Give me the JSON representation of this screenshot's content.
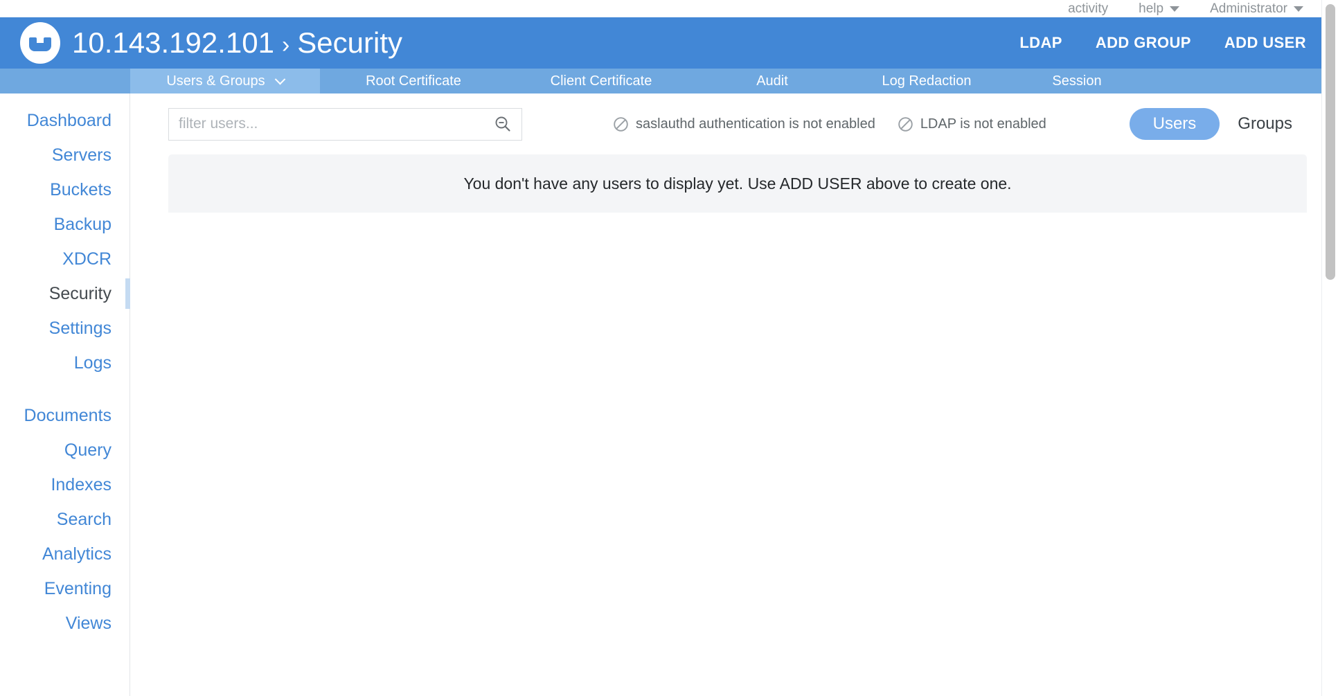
{
  "utility_bar": {
    "items": [
      {
        "label": "activity",
        "has_caret": false
      },
      {
        "label": "help",
        "has_caret": true
      },
      {
        "label": "Administrator",
        "has_caret": true
      }
    ]
  },
  "header": {
    "logo_icon": "couchbase-logo-icon",
    "cluster": "10.143.192.101",
    "separator": "›",
    "section": "Security",
    "actions": [
      "LDAP",
      "ADD GROUP",
      "ADD USER"
    ]
  },
  "tabs": [
    {
      "label": "Users & Groups",
      "active": true,
      "has_caret": true
    },
    {
      "label": "Root Certificate",
      "active": false,
      "has_caret": false
    },
    {
      "label": "Client Certificate",
      "active": false,
      "has_caret": false
    },
    {
      "label": "Audit",
      "active": false,
      "has_caret": false
    },
    {
      "label": "Log Redaction",
      "active": false,
      "has_caret": false
    },
    {
      "label": "Session",
      "active": false,
      "has_caret": false
    }
  ],
  "sidebar": {
    "group_one": [
      {
        "label": "Dashboard",
        "active": false
      },
      {
        "label": "Servers",
        "active": false
      },
      {
        "label": "Buckets",
        "active": false
      },
      {
        "label": "Backup",
        "active": false
      },
      {
        "label": "XDCR",
        "active": false
      },
      {
        "label": "Security",
        "active": true
      },
      {
        "label": "Settings",
        "active": false
      },
      {
        "label": "Logs",
        "active": false
      }
    ],
    "group_two": [
      {
        "label": "Documents",
        "active": false
      },
      {
        "label": "Query",
        "active": false
      },
      {
        "label": "Indexes",
        "active": false
      },
      {
        "label": "Search",
        "active": false
      },
      {
        "label": "Analytics",
        "active": false
      },
      {
        "label": "Eventing",
        "active": false
      },
      {
        "label": "Views",
        "active": false
      }
    ]
  },
  "toolbar": {
    "filter": {
      "value": "",
      "placeholder": "filter users...",
      "icon": "search-zoom-out-icon"
    },
    "statuses": [
      {
        "icon": "prohibited-icon",
        "text": "saslauthd authentication is not enabled"
      },
      {
        "icon": "prohibited-icon",
        "text": "LDAP is not enabled"
      }
    ],
    "toggle": {
      "users_label": "Users",
      "groups_label": "Groups",
      "selected": "Users"
    }
  },
  "main": {
    "empty_message": "You don't have any users to display yet. Use ADD USER above to create one."
  },
  "colors": {
    "header_blue": "#4287d6",
    "tab_blue": "#6fa8e0",
    "tab_active_blue": "#8cbcea",
    "link_blue": "#4287d6",
    "active_indicator": "#c5dbf2",
    "panel_gray": "#f4f5f7",
    "muted_text": "#8e9499"
  }
}
